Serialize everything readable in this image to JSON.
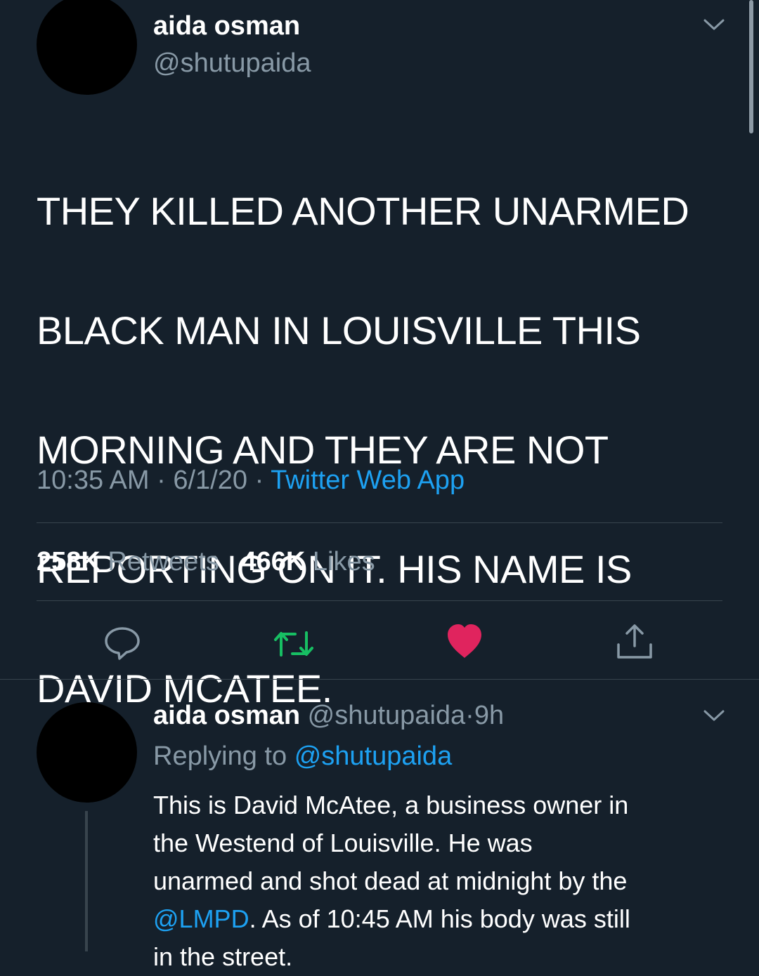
{
  "colors": {
    "background": "#15202b",
    "text": "#ffffff",
    "muted": "#8899a6",
    "link": "#1da1f2",
    "retweet_active": "#17bf63",
    "like_active": "#e0245e",
    "divider": "#38444d"
  },
  "main_tweet": {
    "author_name": "aida osman",
    "author_handle": "@shutupaida",
    "text_lines": [
      "THEY KILLED ANOTHER UNARMED",
      "BLACK MAN IN LOUISVILLE THIS",
      "MORNING AND THEY ARE NOT",
      "REPORTING ON IT. HIS NAME IS",
      "DAVID MCATEE."
    ],
    "time": "10:35 AM",
    "date": "6/1/20",
    "separator": "·",
    "source": "Twitter Web App",
    "retweets_count": "258K",
    "retweets_label": "Retweets",
    "likes_count": "466K",
    "likes_label": "Likes"
  },
  "actions": [
    {
      "name": "reply",
      "icon": "comment-bubble-icon"
    },
    {
      "name": "retweet",
      "icon": "retweet-icon",
      "active": true
    },
    {
      "name": "like",
      "icon": "heart-icon",
      "active": true
    },
    {
      "name": "share",
      "icon": "share-icon"
    }
  ],
  "reply_tweet": {
    "author_name": "aida osman",
    "author_handle": "@shutupaida",
    "separator": "·",
    "time_ago": "9h",
    "replying_prefix": "Replying to",
    "replying_handle": "@shutupaida",
    "line1": "This is David McAtee, a business owner in",
    "line2": "the Westend of Louisville. He was",
    "line3": "unarmed and shot dead at midnight by the",
    "line4_mention": "@LMPD",
    "line4_rest": ". As of 10:45 AM his body was still",
    "line5": "in the street."
  }
}
